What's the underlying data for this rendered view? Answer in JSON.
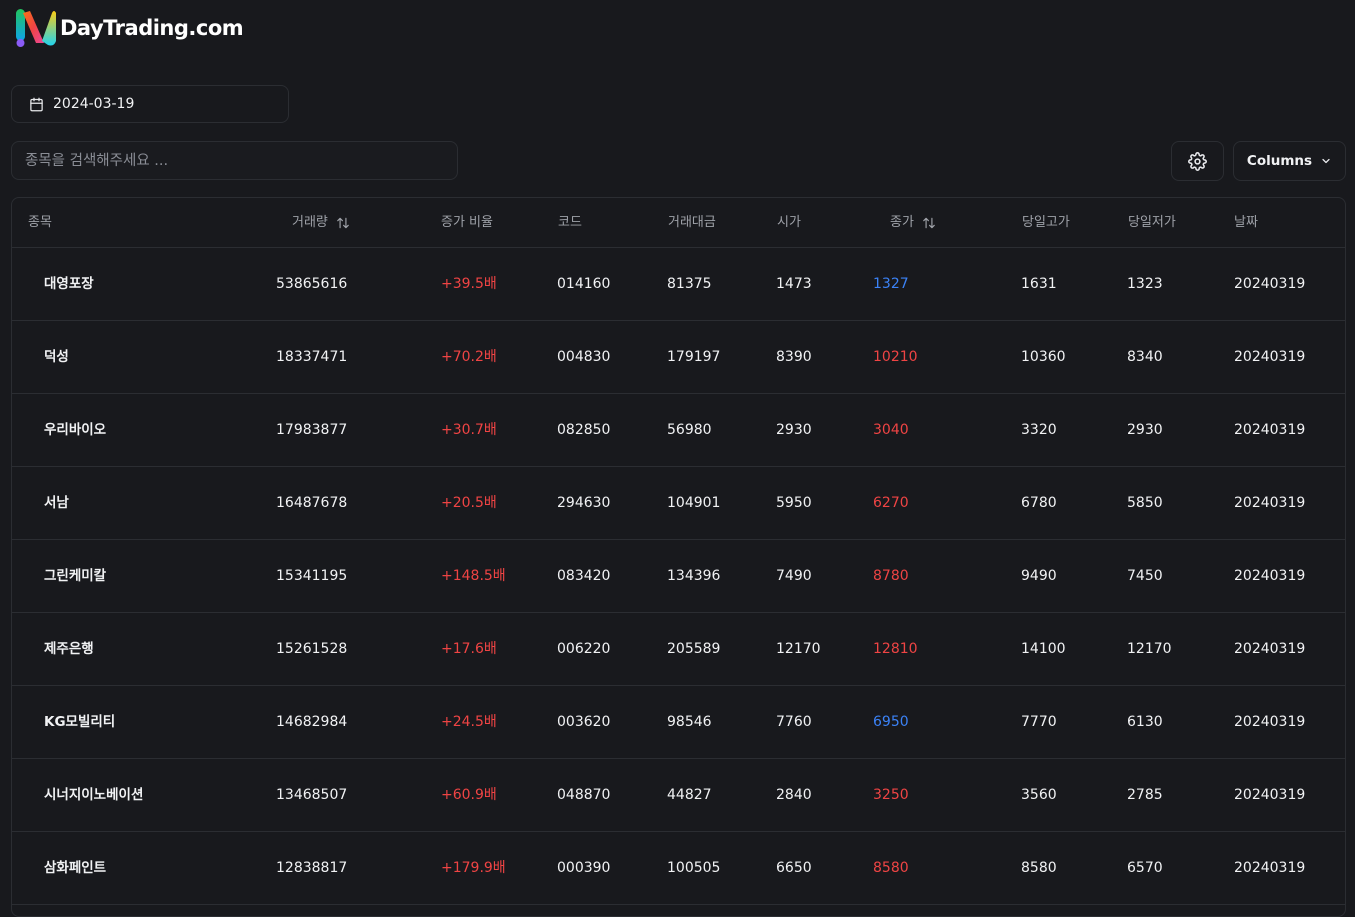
{
  "brand": {
    "name": "DayTrading.com"
  },
  "date_picker": {
    "value": "2024-03-19",
    "icon": "calendar-icon"
  },
  "search": {
    "placeholder": "종목을 검색해주세요 ..."
  },
  "toolbar": {
    "columns_label": "Columns",
    "settings_icon": "gear-icon"
  },
  "colors": {
    "up": "#ef4444",
    "down": "#3b82f6",
    "background": "#18191d"
  },
  "table": {
    "headers": {
      "name": "종목",
      "volume": "거래량",
      "ratio": "증가 비율",
      "code": "코드",
      "amount": "거래대금",
      "open": "시가",
      "close": "종가",
      "high": "당일고가",
      "low": "당일저가",
      "date": "날짜"
    },
    "rows": [
      {
        "name": "대영포장",
        "volume": "53865616",
        "ratio": "+39.5배",
        "code": "014160",
        "amount": "81375",
        "open": "1473",
        "close": "1327",
        "close_dir": "down",
        "high": "1631",
        "low": "1323",
        "date": "20240319"
      },
      {
        "name": "덕성",
        "volume": "18337471",
        "ratio": "+70.2배",
        "code": "004830",
        "amount": "179197",
        "open": "8390",
        "close": "10210",
        "close_dir": "up",
        "high": "10360",
        "low": "8340",
        "date": "20240319"
      },
      {
        "name": "우리바이오",
        "volume": "17983877",
        "ratio": "+30.7배",
        "code": "082850",
        "amount": "56980",
        "open": "2930",
        "close": "3040",
        "close_dir": "up",
        "high": "3320",
        "low": "2930",
        "date": "20240319"
      },
      {
        "name": "서남",
        "volume": "16487678",
        "ratio": "+20.5배",
        "code": "294630",
        "amount": "104901",
        "open": "5950",
        "close": "6270",
        "close_dir": "up",
        "high": "6780",
        "low": "5850",
        "date": "20240319"
      },
      {
        "name": "그린케미칼",
        "volume": "15341195",
        "ratio": "+148.5배",
        "code": "083420",
        "amount": "134396",
        "open": "7490",
        "close": "8780",
        "close_dir": "up",
        "high": "9490",
        "low": "7450",
        "date": "20240319"
      },
      {
        "name": "제주은행",
        "volume": "15261528",
        "ratio": "+17.6배",
        "code": "006220",
        "amount": "205589",
        "open": "12170",
        "close": "12810",
        "close_dir": "up",
        "high": "14100",
        "low": "12170",
        "date": "20240319"
      },
      {
        "name": "KG모빌리티",
        "volume": "14682984",
        "ratio": "+24.5배",
        "code": "003620",
        "amount": "98546",
        "open": "7760",
        "close": "6950",
        "close_dir": "down",
        "high": "7770",
        "low": "6130",
        "date": "20240319"
      },
      {
        "name": "시너지이노베이션",
        "volume": "13468507",
        "ratio": "+60.9배",
        "code": "048870",
        "amount": "44827",
        "open": "2840",
        "close": "3250",
        "close_dir": "up",
        "high": "3560",
        "low": "2785",
        "date": "20240319"
      },
      {
        "name": "삼화페인트",
        "volume": "12838817",
        "ratio": "+179.9배",
        "code": "000390",
        "amount": "100505",
        "open": "6650",
        "close": "8580",
        "close_dir": "up",
        "high": "8580",
        "low": "6570",
        "date": "20240319"
      }
    ]
  }
}
